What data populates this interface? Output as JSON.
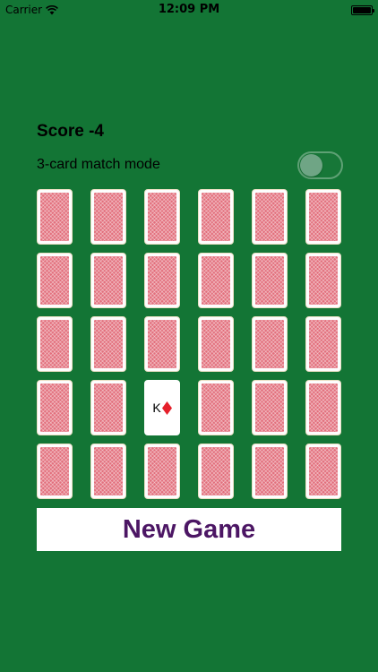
{
  "status_bar": {
    "carrier": "Carrier",
    "time": "12:09 PM",
    "wifi_icon": "wifi-icon",
    "battery_icon": "battery-icon"
  },
  "game": {
    "score_text": "Score -4",
    "mode_label": "3-card match mode",
    "three_card_mode_enabled": false,
    "new_game_label": "New Game"
  },
  "colors": {
    "table_green": "#137535",
    "card_back_red": "#E26F7C",
    "button_text_purple": "#4C1664",
    "diamond_red": "#E5202B"
  },
  "board": {
    "rows": 5,
    "columns": 6,
    "cards": [
      {
        "face_up": false
      },
      {
        "face_up": false
      },
      {
        "face_up": false
      },
      {
        "face_up": false
      },
      {
        "face_up": false
      },
      {
        "face_up": false
      },
      {
        "face_up": false
      },
      {
        "face_up": false
      },
      {
        "face_up": false
      },
      {
        "face_up": false
      },
      {
        "face_up": false
      },
      {
        "face_up": false
      },
      {
        "face_up": false
      },
      {
        "face_up": false
      },
      {
        "face_up": false
      },
      {
        "face_up": false
      },
      {
        "face_up": false
      },
      {
        "face_up": false
      },
      {
        "face_up": false
      },
      {
        "face_up": false
      },
      {
        "face_up": true,
        "rank": "K",
        "suit": "diamond"
      },
      {
        "face_up": false
      },
      {
        "face_up": false
      },
      {
        "face_up": false
      },
      {
        "face_up": false
      },
      {
        "face_up": false
      },
      {
        "face_up": false
      },
      {
        "face_up": false
      },
      {
        "face_up": false
      },
      {
        "face_up": false
      }
    ]
  }
}
